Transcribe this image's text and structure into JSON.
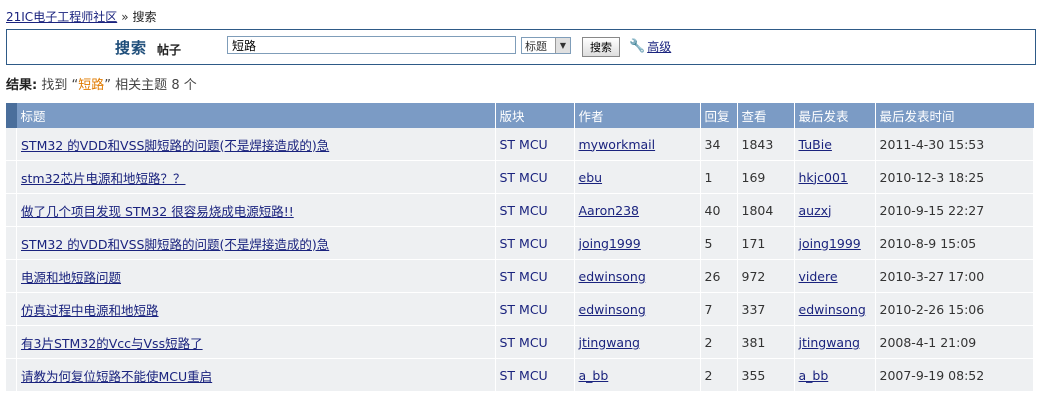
{
  "breadcrumb": {
    "home": "21IC电子工程师社区",
    "sep": "»",
    "current": "搜索"
  },
  "search": {
    "title": "搜索",
    "type_label": "帖子",
    "query": "短路",
    "select_value": "标题",
    "button": "搜索",
    "advanced": "高级"
  },
  "result": {
    "label": "结果:",
    "pre": "找到",
    "open_q": "“",
    "keyword": "短路",
    "close_q": "”",
    "post": "相关主题",
    "count": "8 个"
  },
  "table": {
    "headers": [
      "标题",
      "版块",
      "作者",
      "回复",
      "查看",
      "最后发表",
      "最后发表时间"
    ],
    "rows": [
      {
        "title": "STM32 的VDD和VSS脚短路的问题(不是焊接造成的)急",
        "forum": "ST MCU",
        "author": "myworkmail",
        "replies": "34",
        "views": "1843",
        "last_poster": "TuBie",
        "last_time": "2011-4-30 15:53"
      },
      {
        "title": "stm32芯片电源和地短路？？",
        "forum": "ST MCU",
        "author": "ebu",
        "replies": "1",
        "views": "169",
        "last_poster": "hkjc001",
        "last_time": "2010-12-3 18:25"
      },
      {
        "title": "做了几个项目发现 STM32 很容易烧成电源短路!!",
        "forum": "ST MCU",
        "author": "Aaron238",
        "replies": "40",
        "views": "1804",
        "last_poster": "auzxj",
        "last_time": "2010-9-15 22:27"
      },
      {
        "title": "STM32 的VDD和VSS脚短路的问题(不是焊接造成的)急",
        "forum": "ST MCU",
        "author": "joing1999",
        "replies": "5",
        "views": "171",
        "last_poster": "joing1999",
        "last_time": "2010-8-9 15:05"
      },
      {
        "title": "电源和地短路问题",
        "forum": "ST MCU",
        "author": "edwinsong",
        "replies": "26",
        "views": "972",
        "last_poster": "videre",
        "last_time": "2010-3-27 17:00"
      },
      {
        "title": "仿真过程中电源和地短路",
        "forum": "ST MCU",
        "author": "edwinsong",
        "replies": "7",
        "views": "337",
        "last_poster": "edwinsong",
        "last_time": "2010-2-26 15:06"
      },
      {
        "title": "有3片STM32的Vcc与Vss短路了",
        "forum": "ST MCU",
        "author": "jtingwang",
        "replies": "2",
        "views": "381",
        "last_poster": "jtingwang",
        "last_time": "2008-4-1 21:09"
      },
      {
        "title": "请教为何复位短路不能使MCU重启",
        "forum": "ST MCU",
        "author": "a_bb",
        "replies": "2",
        "views": "355",
        "last_poster": "a_bb",
        "last_time": "2007-9-19 08:52"
      }
    ]
  }
}
